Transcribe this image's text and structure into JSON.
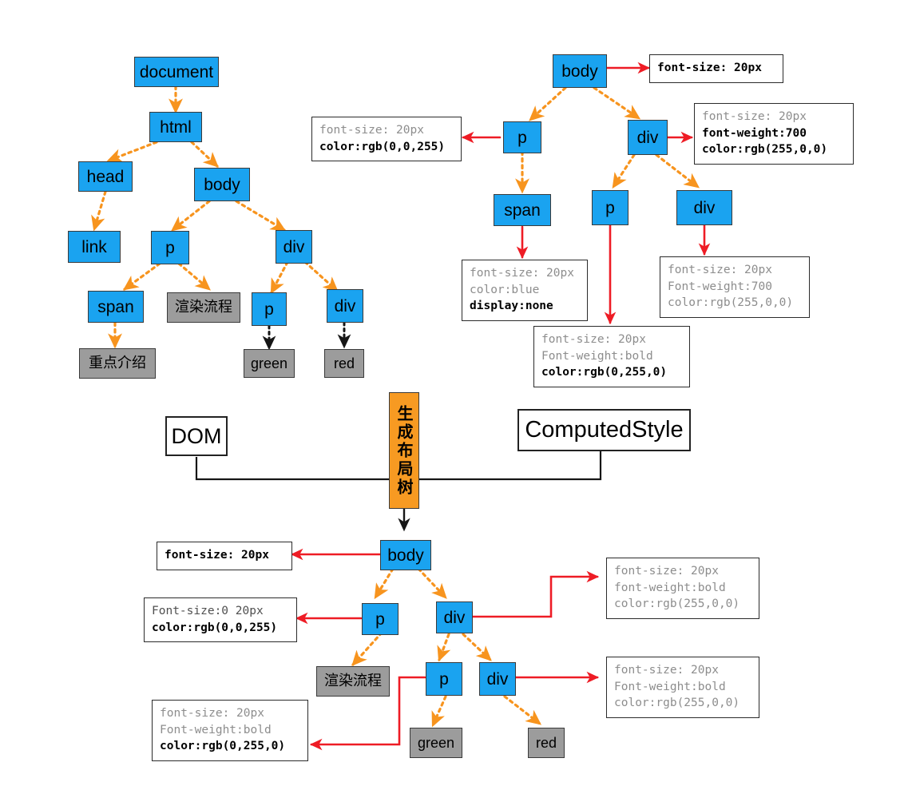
{
  "diagram": {
    "title": "DOM tree + ComputedStyle -> Layout tree",
    "colors": {
      "element_node": "#1aa3f0",
      "text_node": "#9c9c9c",
      "process_box": "#f79a22",
      "dom_edge": "#f7941e",
      "text_edge": "#1a1a1a",
      "style_edge": "#ee1c25",
      "plain_edge": "#1a1a1a",
      "inherited_text": "#8d8d8d",
      "own_text": "#000000"
    }
  },
  "dom_tree": {
    "caption": "DOM",
    "nodes": [
      {
        "id": "document",
        "label": "document",
        "kind": "element"
      },
      {
        "id": "html",
        "label": "html",
        "kind": "element"
      },
      {
        "id": "head",
        "label": "head",
        "kind": "element"
      },
      {
        "id": "body",
        "label": "body",
        "kind": "element"
      },
      {
        "id": "link",
        "label": "link",
        "kind": "element"
      },
      {
        "id": "p1",
        "label": "p",
        "kind": "element"
      },
      {
        "id": "div1",
        "label": "div",
        "kind": "element"
      },
      {
        "id": "span1",
        "label": "span",
        "kind": "element"
      },
      {
        "id": "t_render",
        "label": "渲染流程",
        "kind": "text"
      },
      {
        "id": "p2",
        "label": "p",
        "kind": "element"
      },
      {
        "id": "div2",
        "label": "div",
        "kind": "element"
      },
      {
        "id": "t_focus",
        "label": "重点介绍",
        "kind": "text"
      },
      {
        "id": "t_green",
        "label": "green",
        "kind": "text"
      },
      {
        "id": "t_red",
        "label": "red",
        "kind": "text"
      }
    ]
  },
  "computed_style_tree": {
    "caption": "ComputedStyle",
    "nodes": [
      {
        "id": "cs_body",
        "label": "body",
        "kind": "element"
      },
      {
        "id": "cs_p",
        "label": "p",
        "kind": "element"
      },
      {
        "id": "cs_div",
        "label": "div",
        "kind": "element"
      },
      {
        "id": "cs_span",
        "label": "span",
        "kind": "element"
      },
      {
        "id": "cs_p2",
        "label": "p",
        "kind": "element"
      },
      {
        "id": "cs_div2",
        "label": "div",
        "kind": "element"
      }
    ],
    "styles": [
      {
        "id": "cs_style_body",
        "for": "cs_body",
        "lines": [
          {
            "text": "font-size: 20px",
            "weight": "own"
          }
        ]
      },
      {
        "id": "cs_style_p",
        "for": "cs_p",
        "lines": [
          {
            "text": "font-size: 20px",
            "weight": "inherited"
          },
          {
            "text": "color:rgb(0,0,255)",
            "weight": "own"
          }
        ]
      },
      {
        "id": "cs_style_div",
        "for": "cs_div",
        "lines": [
          {
            "text": "font-size: 20px",
            "weight": "inherited"
          },
          {
            "text": "font-weight:700",
            "weight": "own"
          },
          {
            "text": "color:rgb(255,0,0)",
            "weight": "own"
          }
        ]
      },
      {
        "id": "cs_style_span",
        "for": "cs_span",
        "lines": [
          {
            "text": "font-size: 20px",
            "weight": "inherited"
          },
          {
            "text": "color:blue",
            "weight": "inherited"
          },
          {
            "text": "display:none",
            "weight": "own"
          }
        ]
      },
      {
        "id": "cs_style_p2",
        "for": "cs_p2",
        "lines": [
          {
            "text": "font-size: 20px",
            "weight": "inherited"
          },
          {
            "text": "Font-weight:bold",
            "weight": "inherited"
          },
          {
            "text": "color:rgb(0,255,0)",
            "weight": "own"
          }
        ]
      },
      {
        "id": "cs_style_div2",
        "for": "cs_div2",
        "lines": [
          {
            "text": "font-size: 20px",
            "weight": "inherited"
          },
          {
            "text": "Font-weight:700",
            "weight": "inherited"
          },
          {
            "text": "color:rgb(255,0,0)",
            "weight": "inherited"
          }
        ]
      }
    ]
  },
  "process": {
    "label": "生成布局树",
    "orientation": "vertical"
  },
  "layout_tree": {
    "nodes": [
      {
        "id": "lt_body",
        "label": "body",
        "kind": "element"
      },
      {
        "id": "lt_p",
        "label": "p",
        "kind": "element"
      },
      {
        "id": "lt_div",
        "label": "div",
        "kind": "element"
      },
      {
        "id": "lt_text1",
        "label": "渲染流程",
        "kind": "text"
      },
      {
        "id": "lt_p2",
        "label": "p",
        "kind": "element"
      },
      {
        "id": "lt_div2",
        "label": "div",
        "kind": "element"
      },
      {
        "id": "lt_green",
        "label": "green",
        "kind": "text"
      },
      {
        "id": "lt_red",
        "label": "red",
        "kind": "text"
      }
    ],
    "styles": [
      {
        "id": "lt_style_body",
        "for": "lt_body",
        "lines": [
          {
            "text": "font-size: 20px",
            "weight": "own"
          }
        ]
      },
      {
        "id": "lt_style_p",
        "for": "lt_p",
        "lines": [
          {
            "text": "Font-size:0 20px",
            "weight": "inherited"
          },
          {
            "text": "color:rgb(0,0,255)",
            "weight": "own"
          }
        ]
      },
      {
        "id": "lt_style_div",
        "for": "lt_div",
        "lines": [
          {
            "text": "font-size: 20px",
            "weight": "inherited"
          },
          {
            "text": "font-weight:bold",
            "weight": "inherited"
          },
          {
            "text": "color:rgb(255,0,0)",
            "weight": "inherited"
          }
        ]
      },
      {
        "id": "lt_style_div2",
        "for": "lt_div2",
        "lines": [
          {
            "text": "font-size: 20px",
            "weight": "inherited"
          },
          {
            "text": "Font-weight:bold",
            "weight": "inherited"
          },
          {
            "text": "color:rgb(255,0,0)",
            "weight": "inherited"
          }
        ]
      },
      {
        "id": "lt_style_p2",
        "for": "lt_p2",
        "lines": [
          {
            "text": "font-size: 20px",
            "weight": "inherited"
          },
          {
            "text": "Font-weight:bold",
            "weight": "inherited"
          },
          {
            "text": "color:rgb(0,255,0)",
            "weight": "own"
          }
        ]
      }
    ]
  }
}
